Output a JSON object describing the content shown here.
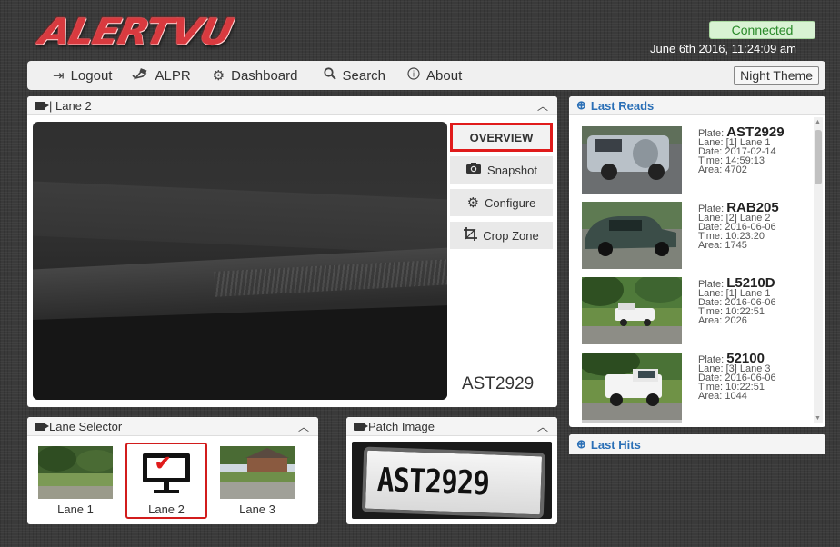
{
  "app": {
    "logo_text": "ALERTVU",
    "status": "Connected",
    "datetime": "June 6th 2016, 11:24:09 am"
  },
  "colors": {
    "accent_red": "#e01b1b",
    "status_green": "#2a8a2a",
    "link_blue": "#2a6fb6"
  },
  "nav": {
    "items": [
      {
        "label": "Logout",
        "icon": "logout-icon"
      },
      {
        "label": "ALPR",
        "icon": "camera-icon"
      },
      {
        "label": "Dashboard",
        "icon": "gears-icon"
      },
      {
        "label": "Search",
        "icon": "search-icon"
      },
      {
        "label": "About",
        "icon": "info-icon"
      }
    ],
    "theme_button": "Night Theme"
  },
  "lane_panel": {
    "title": "| Lane 2",
    "buttons": {
      "overview": "OVERVIEW",
      "snapshot": "Snapshot",
      "configure": "Configure",
      "crop_zone": "Crop Zone"
    },
    "plate": "AST2929"
  },
  "lane_selector": {
    "title": "Lane Selector",
    "lanes": [
      {
        "label": "Lane 1"
      },
      {
        "label": "Lane 2",
        "active": true
      },
      {
        "label": "Lane 3"
      }
    ]
  },
  "patch_image": {
    "title": "Patch Image",
    "plate_text": "AST2929"
  },
  "last_reads": {
    "title": "Last Reads",
    "reads": [
      {
        "plate": "AST2929",
        "lane": "[1] Lane 1",
        "date": "2017-02-14",
        "time": "14:59:13",
        "area": "4702"
      },
      {
        "plate": "RAB205",
        "lane": "[2] Lane 2",
        "date": "2016-06-06",
        "time": "10:23:20",
        "area": "1745"
      },
      {
        "plate": "L5210D",
        "lane": "[1] Lane 1",
        "date": "2016-06-06",
        "time": "10:22:51",
        "area": "2026"
      },
      {
        "plate": "52100",
        "lane": "[3] Lane 3",
        "date": "2016-06-06",
        "time": "10:22:51",
        "area": "1044"
      }
    ],
    "field_labels": {
      "plate": "Plate:",
      "lane": "Lane:",
      "date": "Date:",
      "time": "Time:",
      "area": "Area:"
    }
  },
  "last_hits": {
    "title": "Last Hits"
  }
}
